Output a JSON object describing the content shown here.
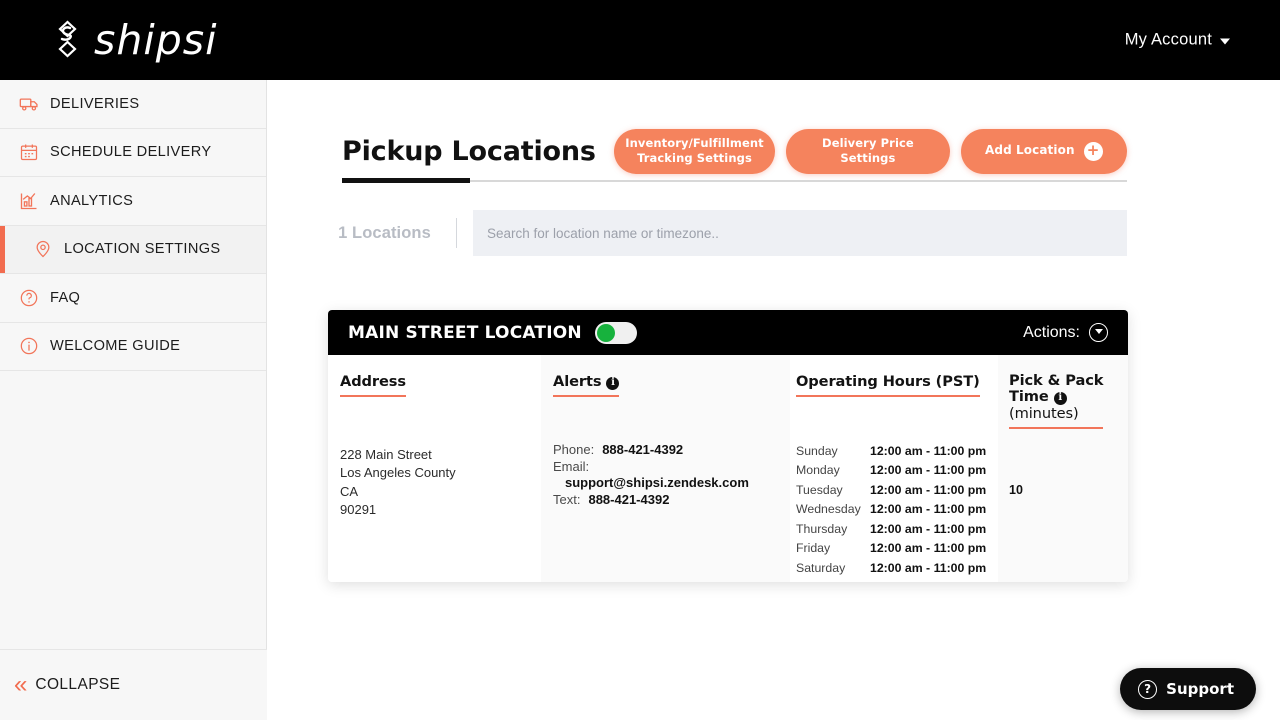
{
  "brand": {
    "name": "shipsi",
    "logo_icon": "shipsi-logo-icon",
    "accent": "#f2755a",
    "bar_bg": "#000000"
  },
  "topbar": {
    "account_label": "My Account",
    "caret_icon": "chevron-down-icon"
  },
  "sidebar": {
    "items": [
      {
        "label": "DELIVERIES",
        "icon": "truck-icon",
        "active": false
      },
      {
        "label": "SCHEDULE DELIVERY",
        "icon": "calendar-icon",
        "active": false
      },
      {
        "label": "ANALYTICS",
        "icon": "bar-chart-icon",
        "active": false
      },
      {
        "label": "LOCATION SETTINGS",
        "icon": "map-pin-icon",
        "active": true
      },
      {
        "label": "FAQ",
        "icon": "question-circle-icon",
        "active": false
      },
      {
        "label": "WELCOME GUIDE",
        "icon": "info-circle-icon",
        "active": false
      }
    ],
    "collapse_label": "COLLAPSE",
    "collapse_icon": "double-chevron-left-icon"
  },
  "page": {
    "title": "Pickup Locations",
    "buttons": [
      {
        "label_line1": "Inventory/Fulfillment",
        "label_line2": "Tracking Settings"
      },
      {
        "label_line1": "Delivery Price",
        "label_line2": "Settings"
      }
    ],
    "add_location": {
      "label": "Add Location",
      "icon": "plus-circle-icon"
    }
  },
  "filter": {
    "count_label": "1 Locations",
    "search_placeholder": "Search for location name or timezone..",
    "search_value": ""
  },
  "location_card": {
    "name": "MAIN STREET LOCATION",
    "enabled": true,
    "toggle_icon": "toggle-switch-icon",
    "actions_label": "Actions:",
    "actions_icon": "chevron-down-circle-icon",
    "address": {
      "heading": "Address",
      "lines": [
        "228 Main Street",
        "Los Angeles County",
        "CA",
        "90291"
      ]
    },
    "alerts": {
      "heading": "Alerts",
      "info_icon": "info-icon",
      "rows": [
        {
          "key": "Phone:",
          "value": "888-421-4392",
          "indent": false
        },
        {
          "key": "Email:",
          "value": "support@shipsi.zendesk.com",
          "indent": true
        },
        {
          "key": "Text:",
          "value": "888-421-4392",
          "indent": false
        }
      ]
    },
    "hours": {
      "heading": "Operating Hours (PST)",
      "rows": [
        {
          "day": "Sunday",
          "time": "12:00 am - 11:00 pm"
        },
        {
          "day": "Monday",
          "time": "12:00 am - 11:00 pm"
        },
        {
          "day": "Tuesday",
          "time": "12:00 am - 11:00 pm"
        },
        {
          "day": "Wednesday",
          "time": "12:00 am - 11:00 pm"
        },
        {
          "day": "Thursday",
          "time": "12:00 am - 11:00 pm"
        },
        {
          "day": "Friday",
          "time": "12:00 am - 11:00 pm"
        },
        {
          "day": "Saturday",
          "time": "12:00 am - 11:00 pm"
        }
      ]
    },
    "pick_pack": {
      "heading_line1": "Pick & Pack",
      "heading_line2": "Time",
      "heading_line3": "(minutes)",
      "info_icon": "info-icon",
      "value": "10"
    }
  },
  "support": {
    "label": "Support",
    "icon": "question-circle-icon"
  }
}
